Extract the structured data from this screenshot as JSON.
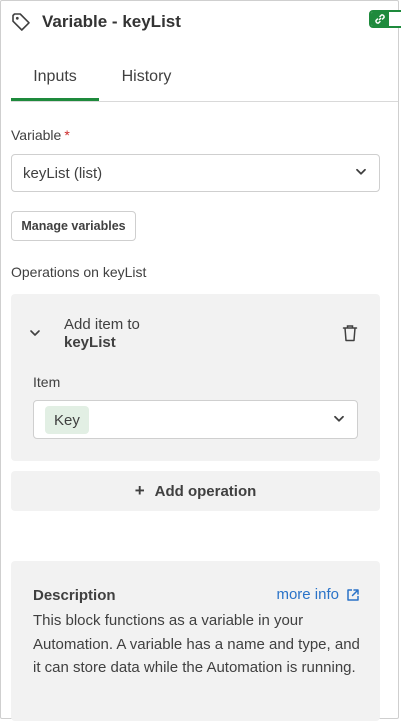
{
  "header": {
    "title": "Variable - keyList",
    "icon": "tag-icon",
    "toggle_icon": "link-icon",
    "accent_color": "#1e8a3c"
  },
  "tabs": [
    {
      "label": "Inputs",
      "active": true
    },
    {
      "label": "History",
      "active": false
    }
  ],
  "variable": {
    "label": "Variable",
    "required_mark": "*",
    "selected": "keyList (list)"
  },
  "manage_button": "Manage variables",
  "operations": {
    "label": "Operations on keyList",
    "items": [
      {
        "title_prefix": "Add item to",
        "title_target": "keyList",
        "field_label": "Item",
        "chip_value": "Key"
      }
    ],
    "add_label": "Add operation"
  },
  "description": {
    "title": "Description",
    "more_info": "more info",
    "text": "This block functions as a variable in your Automation. A variable has a name and type, and it can store data while the Automation is running."
  },
  "colors": {
    "link": "#2a73c8",
    "panel": "#f2f2f2",
    "chip": "#e2efe4",
    "required": "#cc2a2a"
  }
}
